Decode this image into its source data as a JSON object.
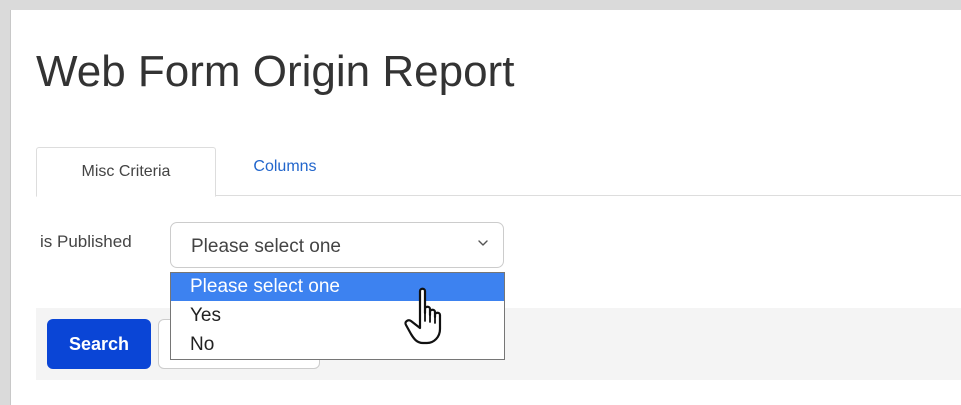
{
  "page": {
    "title": "Web Form Origin Report"
  },
  "tabs": [
    {
      "label": "Misc Criteria",
      "active": true
    },
    {
      "label": "Columns",
      "active": false
    }
  ],
  "filters": {
    "is_published": {
      "label": "is Published",
      "selected": "Please select one",
      "options": [
        "Please select one",
        "Yes",
        "No"
      ],
      "highlighted": "Please select one"
    }
  },
  "actions": {
    "search_label": "Search"
  },
  "colors": {
    "primary_button": "#0a45d6",
    "link": "#2266cc",
    "highlight": "#3d82f0"
  },
  "icons": {
    "select_chevron": "chevron-down-icon",
    "cursor": "hand-pointer-icon"
  }
}
